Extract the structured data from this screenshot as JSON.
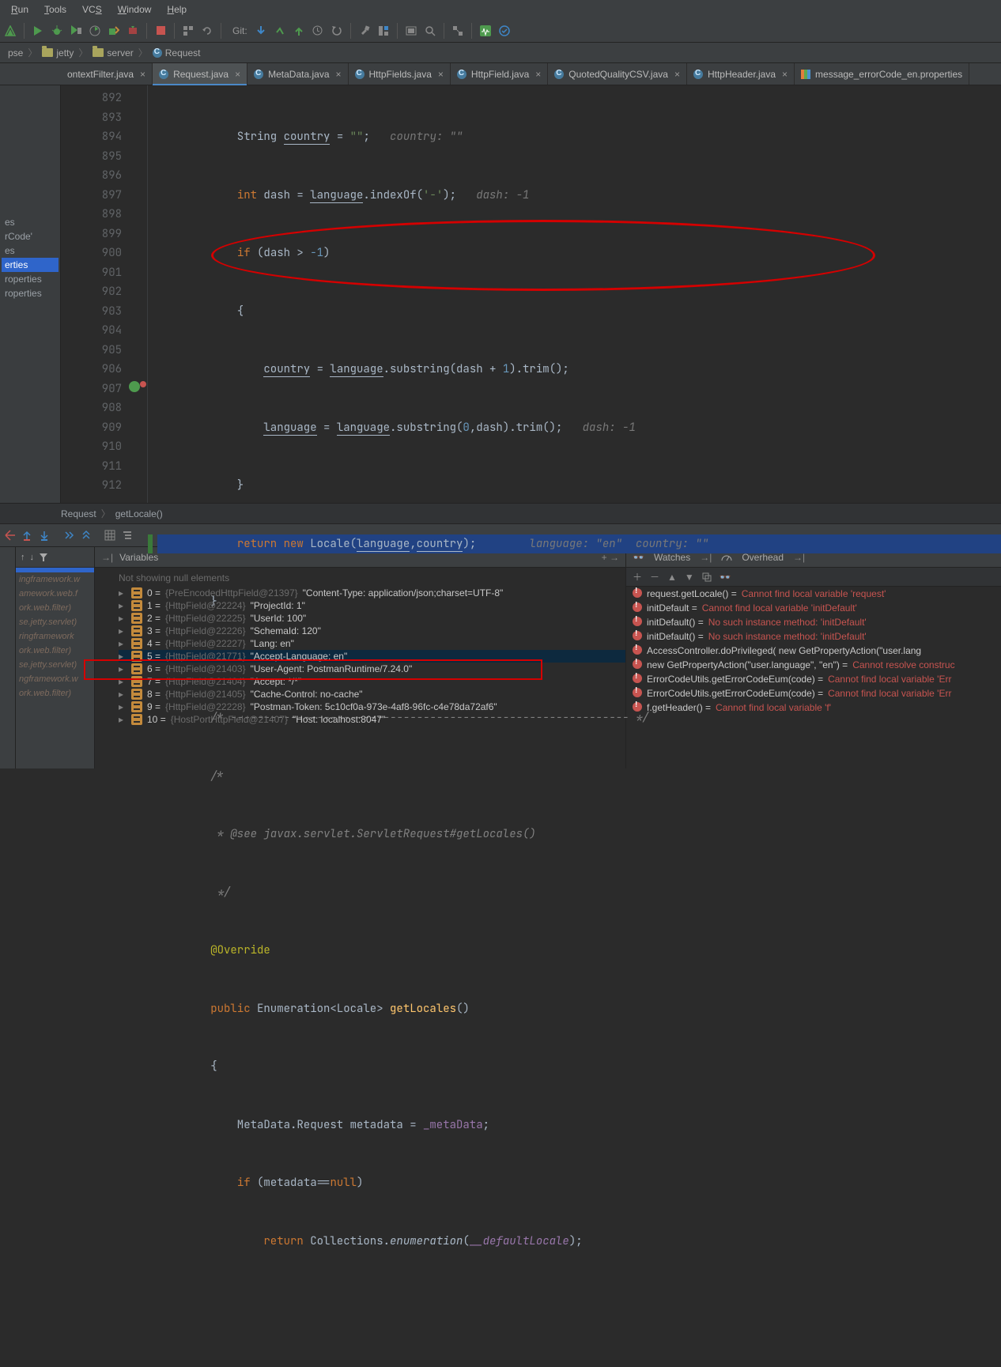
{
  "menu": {
    "run": "Run",
    "tools": "Tools",
    "vcs": "VCS",
    "window": "Window",
    "help": "Help"
  },
  "toolbar": {
    "git": "Git:"
  },
  "breadcrumbs": {
    "c0": "pse",
    "c1": "jetty",
    "c2": "server",
    "c3": "Request"
  },
  "tabs": {
    "t0": "ontextFilter.java",
    "t1": "Request.java",
    "t2": "MetaData.java",
    "t3": "HttpFields.java",
    "t4": "HttpField.java",
    "t5": "QuotedQualityCSV.java",
    "t6": "HttpHeader.java",
    "t7": "message_errorCode_en.properties"
  },
  "sidebar": {
    "i0": "",
    "i1": "es",
    "i2": "rCode'",
    "i3": "es",
    "i4": "erties",
    "i5": "roperties",
    "i6": "roperties"
  },
  "gutter": {
    "l892": "892",
    "l893": "893",
    "l894": "894",
    "l895": "895",
    "l896": "896",
    "l897": "897",
    "l898": "898",
    "l899": "899",
    "l900": "900",
    "l901": "901",
    "l902": "902",
    "l903": "903",
    "l904": "904",
    "l905": "905",
    "l906": "906",
    "l907": "907",
    "l908": "908",
    "l909": "909",
    "l910": "910",
    "l911": "911",
    "l912": "912"
  },
  "code": {
    "l892": {
      "pre": "            String ",
      "u": "country",
      "post": " = ",
      "str": "\"\"",
      "sc": ";   ",
      "hint": "country: \"\""
    },
    "l893": {
      "pre": "            ",
      "kw": "int",
      "post": " dash = ",
      "u": "language",
      "post2": ".indexOf(",
      "str": "'-'",
      "post3": ");   ",
      "hint": "dash: -1"
    },
    "l894": {
      "pre": "            ",
      "kw": "if",
      "post": " (dash > ",
      "num": "-1",
      "post2": ")"
    },
    "l895": "            {",
    "l896": {
      "pre": "                ",
      "u": "country",
      "post": " = ",
      "u2": "language",
      "post2": ".substring(dash + ",
      "num": "1",
      "post3": ").trim();"
    },
    "l897": {
      "pre": "                ",
      "u": "language",
      "post": " = ",
      "u2": "language",
      "post2": ".substring(",
      "num": "0",
      "post3": ",dash).trim();   ",
      "hint": "dash: -1"
    },
    "l898": "            }",
    "l899": {
      "pre": "            ",
      "kw": "return new",
      "post": " Locale(",
      "u": "language",
      "post2": ",",
      "u2": "country",
      "post3": ");        ",
      "hint": "language: \"en\"  country: \"\""
    },
    "l900": "        }",
    "l901": "",
    "l902": {
      "pre": "        ",
      "cmt": "/* ------------------------------------------------------------ */"
    },
    "l903": {
      "pre": "        ",
      "cmt": "/*"
    },
    "l904": {
      "pre": "        ",
      "cmt": " * @see javax.servlet.ServletRequest#getLocales()"
    },
    "l905": {
      "pre": "        ",
      "cmt": " */"
    },
    "l906": {
      "pre": "        ",
      "ann": "@Override"
    },
    "l907": {
      "pre": "        ",
      "kw": "public",
      "post": " Enumeration<Locale> ",
      "fn": "getLocales",
      "post2": "()"
    },
    "l908": "        {",
    "l909": {
      "pre": "            MetaData.Request metadata = ",
      "fld": "_metaData",
      "post": ";"
    },
    "l910": {
      "pre": "            ",
      "kw": "if",
      "post": " (metadata==",
      "kw2": "null",
      "post2": ")"
    },
    "l911": {
      "pre": "                ",
      "kw": "return",
      "post": " Collections.",
      "it": "enumeration",
      "post2": "(",
      "fld": "__defaultLocale",
      "post3": ");"
    },
    "l912": ""
  },
  "editor_crumb": {
    "c0": "Request",
    "c1": "getLocale()"
  },
  "vars": {
    "title": "Variables",
    "msg": "Not showing null elements",
    "r0": {
      "k": "0",
      "id": "{PreEncodedHttpField@21397}",
      "v": "\"Content-Type: application/json;charset=UTF-8\""
    },
    "r1": {
      "k": "1",
      "id": "{HttpField@22224}",
      "v": "\"ProjectId: 1\""
    },
    "r2": {
      "k": "2",
      "id": "{HttpField@22225}",
      "v": "\"UserId: 100\""
    },
    "r3": {
      "k": "3",
      "id": "{HttpField@22226}",
      "v": "\"SchemaId: 120\""
    },
    "r4": {
      "k": "4",
      "id": "{HttpField@22227}",
      "v": "\"Lang: en\""
    },
    "r5": {
      "k": "5",
      "id": "{HttpField@21771}",
      "v": "\"Accept-Language: en\""
    },
    "r6": {
      "k": "6",
      "id": "{HttpField@21403}",
      "v": "\"User-Agent: PostmanRuntime/7.24.0\""
    },
    "r7": {
      "k": "7",
      "id": "{HttpField@21404}",
      "v": "\"Accept: */*\""
    },
    "r8": {
      "k": "8",
      "id": "{HttpField@21405}",
      "v": "\"Cache-Control: no-cache\""
    },
    "r9": {
      "k": "9",
      "id": "{HttpField@22228}",
      "v": "\"Postman-Token: 5c10cf0a-973e-4af8-96fc-c4e78da72af6\""
    },
    "r10": {
      "k": "10",
      "id": "{HostPortHttpField@21407}",
      "v": "\"Host: localhost:8047\""
    }
  },
  "watch": {
    "title": "Watches",
    "overhead": "Overhead",
    "r0": {
      "e": "request.getLocale() = ",
      "v": "Cannot find local variable 'request'"
    },
    "r1": {
      "e": "initDefault = ",
      "v": "Cannot find local variable 'initDefault'"
    },
    "r2": {
      "e": "initDefault() = ",
      "v": "No such instance method: 'initDefault'"
    },
    "r3": {
      "e": "initDefault() = ",
      "v": "No such instance method: 'initDefault'"
    },
    "r4": {
      "e": "AccessController.doPrivileged(                new GetPropertyAction(\"user.lang"
    },
    "r5": {
      "e": "new GetPropertyAction(\"user.language\", \"en\") = ",
      "v": "Cannot resolve construc"
    },
    "r6": {
      "e": "ErrorCodeUtils.getErrorCodeEum(code) = ",
      "v": "Cannot find local variable 'Err"
    },
    "r7": {
      "e": "ErrorCodeUtils.getErrorCodeEum(code) = ",
      "v": "Cannot find local variable 'Err"
    },
    "r8": {
      "e": "f.getHeader() = ",
      "v": "Cannot find local variable 'f'"
    }
  },
  "frames": {
    "f0": "",
    "f1": "ingframework.w",
    "f2": "amework.web.f",
    "f3": "ork.web.filter)",
    "f4": "se.jetty.servlet)",
    "f5": "ringframework",
    "f6": "ork.web.filter)",
    "f7": "se.jetty.servlet)",
    "f8": "ngframework.w",
    "f9": "ork.web.filter)"
  }
}
